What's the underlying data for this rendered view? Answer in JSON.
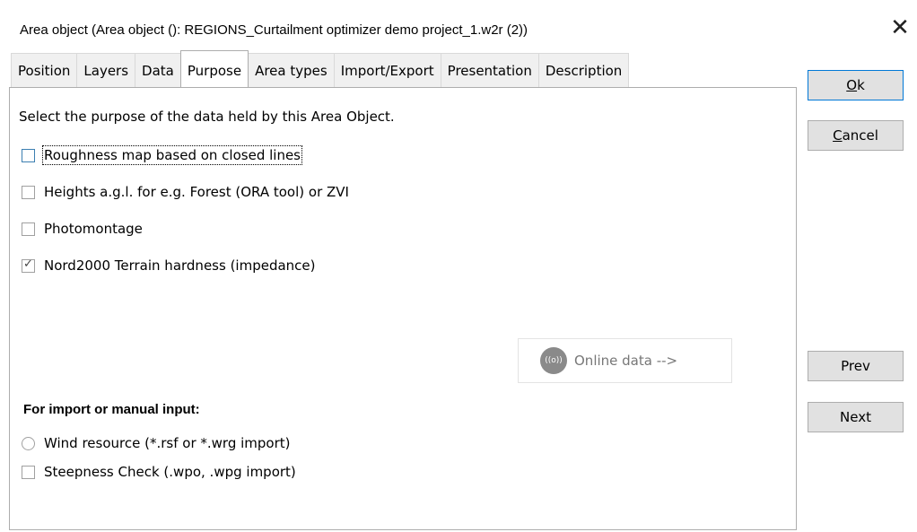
{
  "window": {
    "title": "Area object   (Area object (): REGIONS_Curtailment optimizer demo project_1.w2r (2))",
    "close_glyph": "✕"
  },
  "tabs": [
    {
      "label": "Position"
    },
    {
      "label": "Layers"
    },
    {
      "label": "Data"
    },
    {
      "label": "Purpose",
      "active": true
    },
    {
      "label": "Area types"
    },
    {
      "label": "Import/Export"
    },
    {
      "label": "Presentation"
    },
    {
      "label": "Description"
    }
  ],
  "purpose": {
    "intro": "Select the purpose of the data held by this Area Object.",
    "options": [
      {
        "label": "Roughness map based on closed lines",
        "checked": false
      },
      {
        "label": "Heights a.g.l. for e.g. Forest (ORA tool) or ZVI",
        "checked": false
      },
      {
        "label": "Photomontage",
        "checked": false
      },
      {
        "label": "Nord2000 Terrain hardness (impedance)",
        "checked": true
      }
    ],
    "online_button": {
      "label": "Online data -->",
      "icon": "online-data-icon",
      "icon_text": "((o))"
    },
    "import_section": {
      "heading": "For import or manual input:",
      "wind_resource": "Wind resource (*.rsf or *.wrg import)",
      "steepness": "Steepness Check (.wpo, .wpg import)"
    }
  },
  "buttons": {
    "ok": {
      "accel": "O",
      "rest": "k"
    },
    "cancel": {
      "accel": "C",
      "rest": "ancel"
    },
    "prev": "Prev",
    "next": "Next"
  },
  "colors": {
    "default_button_border": "#0078d7",
    "focus_checkbox_border": "#3c7fb1"
  }
}
